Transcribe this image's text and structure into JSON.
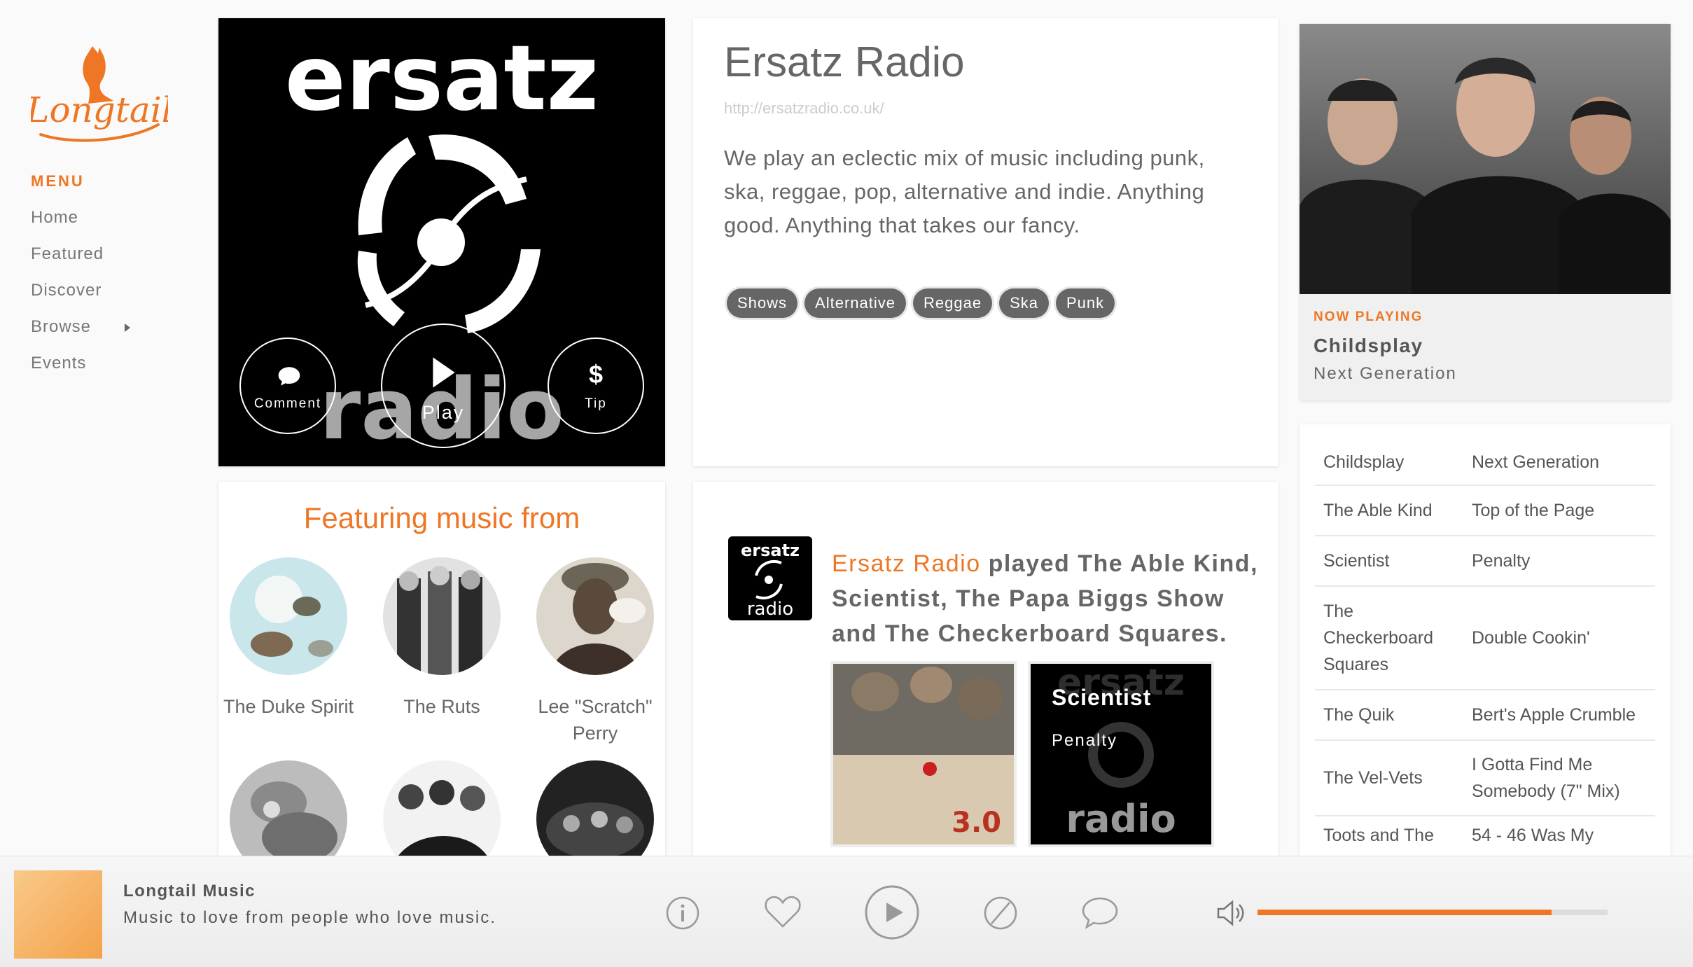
{
  "brand": {
    "logo_text": "Longtail"
  },
  "sidebar": {
    "menu_title": "MENU",
    "items": [
      {
        "label": "Home"
      },
      {
        "label": "Featured"
      },
      {
        "label": "Discover"
      },
      {
        "label": "Browse"
      },
      {
        "label": "Events"
      }
    ]
  },
  "station": {
    "art_top_text": "ersatz",
    "art_bottom_text": "radio",
    "actions": {
      "comment": "Comment",
      "play": "Play",
      "tip": "Tip",
      "tip_symbol": "$"
    },
    "title": "Ersatz Radio",
    "url": "http://ersatzradio.co.uk/",
    "description": "We play an eclectic mix of music including punk, ska, reggae, pop, alternative and indie. Anything good. Anything that takes our fancy.",
    "tags": [
      "Shows",
      "Alternative",
      "Reggae",
      "Ska",
      "Punk"
    ]
  },
  "now_playing": {
    "label": "NOW PLAYING",
    "title": "Childsplay",
    "artist": "Next Generation"
  },
  "tracklist": [
    {
      "artist": "Childsplay",
      "track": "Next Generation"
    },
    {
      "artist": "The Able Kind",
      "track": "Top of the Page"
    },
    {
      "artist": "Scientist",
      "track": "Penalty"
    },
    {
      "artist": "The Checkerboard Squares",
      "track": "Double Cookin'"
    },
    {
      "artist": "The Quik",
      "track": "Bert's Apple Crumble"
    },
    {
      "artist": "The Vel-Vets",
      "track": "I Gotta Find Me Somebody (7\" Mix)"
    },
    {
      "artist": "Toots and The",
      "track": "54 - 46 Was My"
    }
  ],
  "featuring": {
    "title": "Featuring music from",
    "artists": [
      {
        "name": "The Duke Spirit"
      },
      {
        "name": "The Ruts"
      },
      {
        "name": "Lee \"Scratch\" Perry"
      },
      {
        "name": ""
      },
      {
        "name": ""
      },
      {
        "name": ""
      }
    ]
  },
  "activity": {
    "logo_top": "ersatz",
    "logo_bottom": "radio",
    "station_name": "Ersatz Radio",
    "text": " played The Able Kind, Scientist, The Papa Biggs Show and The Checkerboard Squares.",
    "album1": {
      "badge": "3.0"
    },
    "album2": {
      "title": "Scientist",
      "subtitle": "Penalty",
      "bg_top": "ersatz",
      "bg_bottom": "radio"
    }
  },
  "player": {
    "title": "Longtail Music",
    "subtitle": "Music to love from people who love music.",
    "volume": 0.84,
    "icons": [
      "info-icon",
      "heart-icon",
      "play-icon",
      "block-icon",
      "chat-icon",
      "volume-icon"
    ]
  },
  "colors": {
    "accent": "#ee7624",
    "tag_bg": "#666666"
  }
}
